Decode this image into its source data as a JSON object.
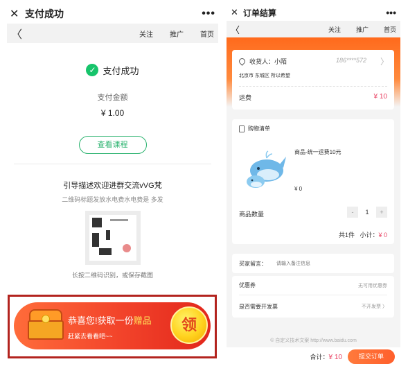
{
  "left": {
    "title": "支付成功",
    "menu_dots": "•••",
    "close_glyph": "✕",
    "back_glyph": "〈",
    "nav": [
      "关注",
      "推广",
      "首页"
    ],
    "status": {
      "check": "✓",
      "text": "支付成功"
    },
    "amount_label": "支付金额",
    "amount_value": "¥ 1.00",
    "course_button": "查看课程",
    "guide_title": "引导描述欢迎进群交流vVG梵",
    "guide_subtitle": "二维码标题发放水电费水电费是 多发",
    "qr_tip": "长按二维码识别，或保存截图",
    "gift": {
      "title_prefix": "恭喜您!获取一份",
      "title_highlight": "赠品",
      "subtitle": "赶紧去看看吧~~",
      "button": "领"
    }
  },
  "right": {
    "title": "订单结算",
    "menu_dots": "•••",
    "close_glyph": "✕",
    "back_glyph": "〈",
    "nav": [
      "关注",
      "推广",
      "首页"
    ],
    "address": {
      "recipient": "收货人：小陌",
      "phone": "186****572",
      "line": "北京市 东城区 所以希望",
      "arrow": "〉"
    },
    "freight": {
      "label": "运费",
      "value": "¥ 10"
    },
    "cart": {
      "header": "购物清单",
      "product_name": "商品-统一运费10元",
      "product_price": "¥ 0",
      "qty_label": "商品数量",
      "minus": "-",
      "qty": "1",
      "plus": "+",
      "summary_count": "共1件",
      "summary_subtotal_label": "小计：",
      "summary_subtotal_value": "¥ 0"
    },
    "message": {
      "label": "买家留言：",
      "placeholder": "请输入备注信息"
    },
    "coupon": {
      "label": "优惠券",
      "value": "无可用优惠券"
    },
    "invoice": {
      "label": "是否需要开发票",
      "value": "不开发票 〉"
    },
    "footer_note": "© 自定义技术文案 http://www.baidu.com",
    "total_label": "合计：",
    "total_value": "¥ 10",
    "submit_button": "提交订单"
  }
}
